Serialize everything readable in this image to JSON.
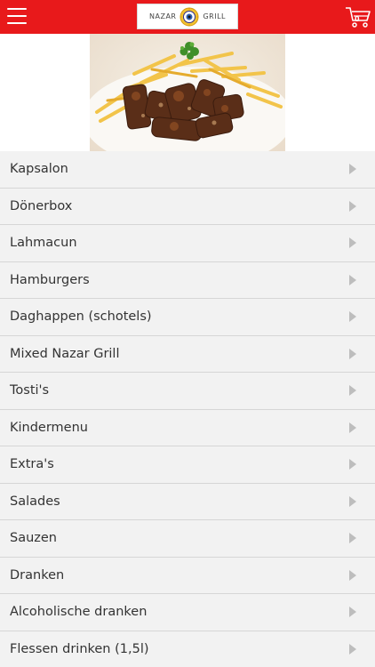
{
  "header": {
    "logo_left": "NAZAR",
    "logo_right": "GRILL",
    "cart_count": "0",
    "colors": {
      "bar": "#e8191b",
      "text_on_bar": "#ffffff"
    }
  },
  "icons": {
    "menu": "hamburger-icon",
    "cart": "cart-icon",
    "chevron": "chevron-right-icon"
  },
  "categories": [
    {
      "label": "Kapsalon"
    },
    {
      "label": "Dönerbox"
    },
    {
      "label": "Lahmacun"
    },
    {
      "label": "Hamburgers"
    },
    {
      "label": "Daghappen (schotels)"
    },
    {
      "label": "Mixed Nazar Grill"
    },
    {
      "label": "Tosti's"
    },
    {
      "label": "Kindermenu"
    },
    {
      "label": "Extra's"
    },
    {
      "label": "Salades"
    },
    {
      "label": "Sauzen"
    },
    {
      "label": "Dranken"
    },
    {
      "label": "Alcoholische dranken"
    },
    {
      "label": "Flessen drinken (1,5l)"
    }
  ]
}
